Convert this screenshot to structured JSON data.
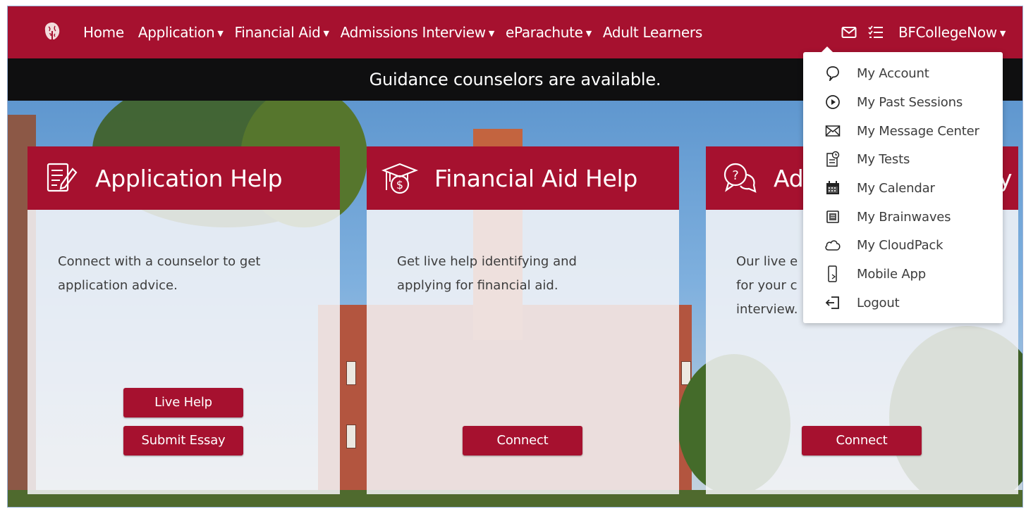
{
  "nav": {
    "items": [
      {
        "label": "Home",
        "has_caret": false
      },
      {
        "label": "Application",
        "has_caret": true
      },
      {
        "label": "Financial Aid",
        "has_caret": true
      },
      {
        "label": "Admissions Interview",
        "has_caret": true
      },
      {
        "label": "eParachute",
        "has_caret": true
      },
      {
        "label": "Adult Learners",
        "has_caret": false
      }
    ],
    "caret_glyph": "▼",
    "user_label": "BFCollegeNow",
    "icons": [
      "brain-logo-icon",
      "envelope-icon",
      "task-list-icon",
      "caret-down-icon"
    ]
  },
  "announcement": "Guidance counselors are available.",
  "cards": [
    {
      "title": "Application Help",
      "icon": "document-pen-icon",
      "description": "Connect with a counselor to get application advice.",
      "buttons": [
        "Live Help",
        "Submit Essay"
      ]
    },
    {
      "title": "Financial Aid Help",
      "icon": "graduation-cap-dollar-icon",
      "description": "Get live help identifying and applying for financial aid.",
      "buttons": [
        "Connect"
      ]
    },
    {
      "title": "Ad",
      "title_right_fragment": "y",
      "icon": "chat-question-icon",
      "description_lines": [
        "Our live e",
        "for your c",
        "interview."
      ],
      "buttons": [
        "Connect"
      ]
    }
  ],
  "dropdown": {
    "items": [
      {
        "label": "My Account",
        "icon": "speech-bubble-icon"
      },
      {
        "label": "My Past Sessions",
        "icon": "play-circle-icon"
      },
      {
        "label": "My Message Center",
        "icon": "envelope-icon"
      },
      {
        "label": "My Tests",
        "icon": "test-clipboard-icon"
      },
      {
        "label": "My Calendar",
        "icon": "calendar-icon"
      },
      {
        "label": "My Brainwaves",
        "icon": "notepad-icon"
      },
      {
        "label": "My CloudPack",
        "icon": "cloud-icon"
      },
      {
        "label": "Mobile App",
        "icon": "mobile-phone-icon"
      },
      {
        "label": "Logout",
        "icon": "logout-icon"
      }
    ]
  },
  "colors": {
    "brand": "#a6112f",
    "announce_bg": "#0f0f10",
    "text": "#3d3d3d"
  }
}
